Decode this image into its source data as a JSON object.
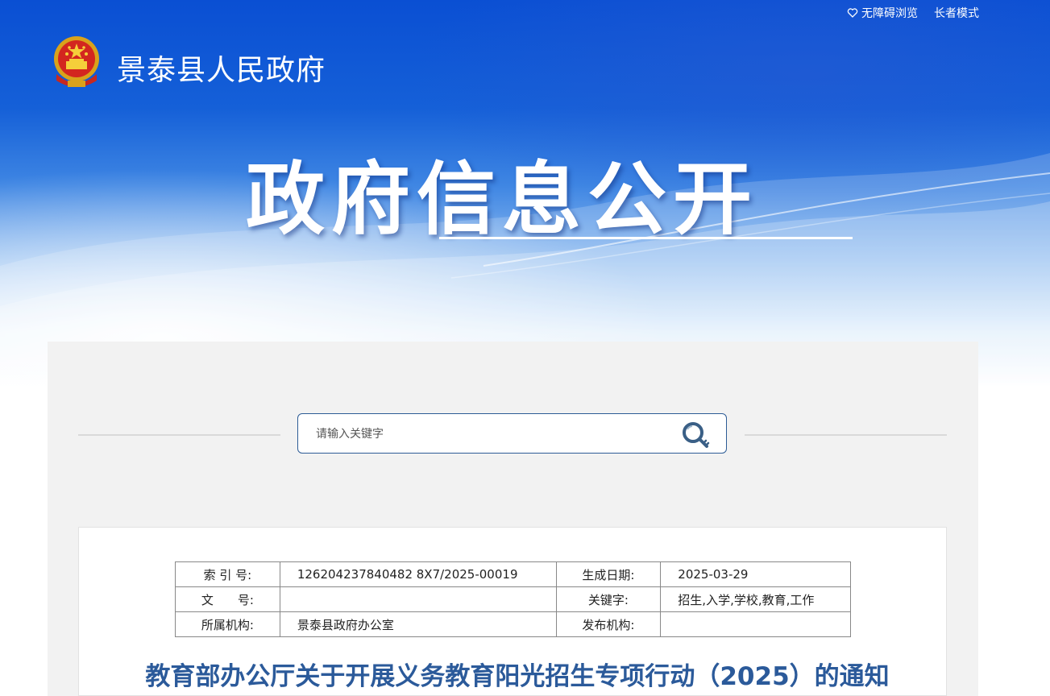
{
  "header": {
    "accessibility_label": "无障碍浏览",
    "elder_mode_label": "长者模式",
    "site_name": "景泰县人民政府",
    "banner_title": "政府信息公开"
  },
  "search": {
    "placeholder": "请输入关键字"
  },
  "meta": {
    "rows": [
      {
        "label1": "索 引 号:",
        "value1": "126204237840482 8X7/2025-00019",
        "label2": "生成日期:",
        "value2": "2025-03-29"
      },
      {
        "label1": "文　　号:",
        "value1": "",
        "label2": "关键字:",
        "value2": "招生,入学,学校,教育,工作"
      },
      {
        "label1": "所属机构:",
        "value1": "景泰县政府办公室",
        "label2": "发布机构:",
        "value2": ""
      }
    ]
  },
  "document": {
    "title": "教育部办公厅关于开展义务教育阳光招生专项行动（2025）的通知"
  },
  "colors": {
    "brand_blue": "#0a4fd3",
    "title_blue": "#2b5a9a",
    "search_border": "#2d5c96",
    "panel_bg": "#f2f2f2"
  },
  "icons": {
    "accessibility": "heart-outline-icon",
    "search": "magnifier-key-icon",
    "logo": "national-emblem-icon"
  }
}
